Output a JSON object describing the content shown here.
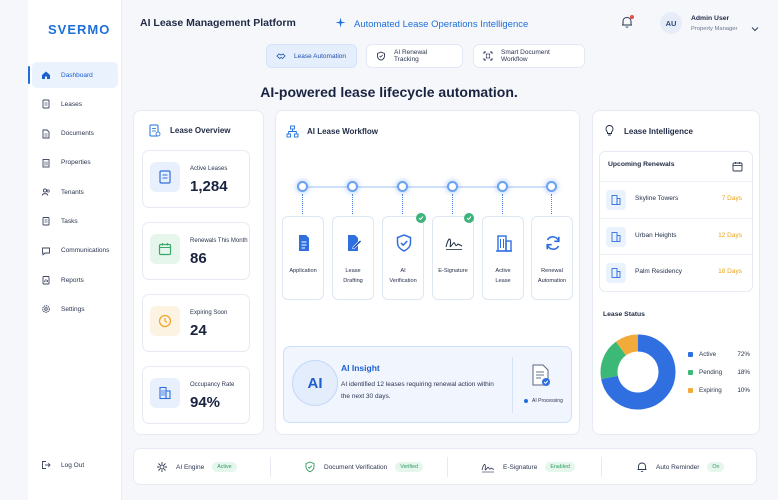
{
  "brand": "SVERMO",
  "sidebar": {
    "items": [
      {
        "label": "Dashboard",
        "icon": "home-icon",
        "active": true
      },
      {
        "label": "Leases",
        "icon": "document-icon"
      },
      {
        "label": "Documents",
        "icon": "file-icon"
      },
      {
        "label": "Properties",
        "icon": "building-icon"
      },
      {
        "label": "Tenants",
        "icon": "users-icon"
      },
      {
        "label": "Tasks",
        "icon": "checklist-icon"
      },
      {
        "label": "Communications",
        "icon": "chat-icon"
      },
      {
        "label": "Reports",
        "icon": "report-icon"
      },
      {
        "label": "Settings",
        "icon": "gear-icon"
      }
    ],
    "logout": "Log Out"
  },
  "header": {
    "title": "AI Lease Management Platform",
    "tagline": "Automated Lease Operations Intelligence",
    "avatar_initials": "AU",
    "user_name": "Admin User",
    "user_role": "Property Manager"
  },
  "pills": [
    {
      "label": "Lease Automation",
      "icon": "handshake-icon",
      "active": true
    },
    {
      "label": "AI Renewal Tracking",
      "icon": "shield-icon"
    },
    {
      "label": "Smart Document Workflow",
      "icon": "scan-icon"
    }
  ],
  "headline": "AI-powered lease lifecycle automation.",
  "overview": {
    "title": "Lease Overview",
    "stats": [
      {
        "label": "Active Leases",
        "value": "1,284",
        "color": "#2f6fe0"
      },
      {
        "label": "Renewals This Month",
        "value": "86",
        "color": "#38a86a"
      },
      {
        "label": "Expiring Soon",
        "value": "24",
        "color": "#f0a82b"
      },
      {
        "label": "Occupancy Rate",
        "value": "94%",
        "color": "#2f6fe0"
      }
    ]
  },
  "workflow": {
    "title": "AI Lease Workflow",
    "steps": [
      {
        "label": "Application",
        "label2": "",
        "icon": "document-icon",
        "done": false
      },
      {
        "label": "Lease",
        "label2": "Drafting",
        "icon": "edit-document-icon",
        "done": false
      },
      {
        "label": "AI",
        "label2": "Verification",
        "icon": "shield-check-icon",
        "done": true
      },
      {
        "label": "E-Signature",
        "label2": "",
        "icon": "signature-icon",
        "done": true
      },
      {
        "label": "Active",
        "label2": "Lease",
        "icon": "building-icon",
        "done": false
      },
      {
        "label": "Renewal",
        "label2": "Automation",
        "icon": "refresh-icon",
        "done": false
      }
    ]
  },
  "insight": {
    "badge": "AI",
    "title": "AI Insight",
    "text": "AI identified 12 leases requiring renewal action within the next 30 days.",
    "status": "AI Processing"
  },
  "intelligence": {
    "title": "Lease Intelligence",
    "renewals_title": "Upcoming Renewals",
    "renewals": [
      {
        "name": "Skyline Towers",
        "days": "7 Days"
      },
      {
        "name": "Urban Heights",
        "days": "12 Days"
      },
      {
        "name": "Palm Residency",
        "days": "18 Days"
      }
    ],
    "status_title": "Lease Status",
    "status": [
      {
        "label": "Active",
        "pct": "72%",
        "value": 72,
        "color": "#2f6fe0"
      },
      {
        "label": "Pending",
        "pct": "18%",
        "value": 18,
        "color": "#3cb877"
      },
      {
        "label": "Expiring",
        "pct": "10%",
        "value": 10,
        "color": "#f2aa3a"
      }
    ]
  },
  "bottom": [
    {
      "label": "AI Engine",
      "badge": "Active",
      "icon": "ai-chip-icon"
    },
    {
      "label": "Document Verification",
      "badge": "Verified",
      "icon": "shield-check-icon"
    },
    {
      "label": "E-Signature",
      "badge": "Enabled",
      "icon": "signature-icon"
    },
    {
      "label": "Auto Reminder",
      "badge": "On",
      "icon": "bell-icon"
    }
  ]
}
